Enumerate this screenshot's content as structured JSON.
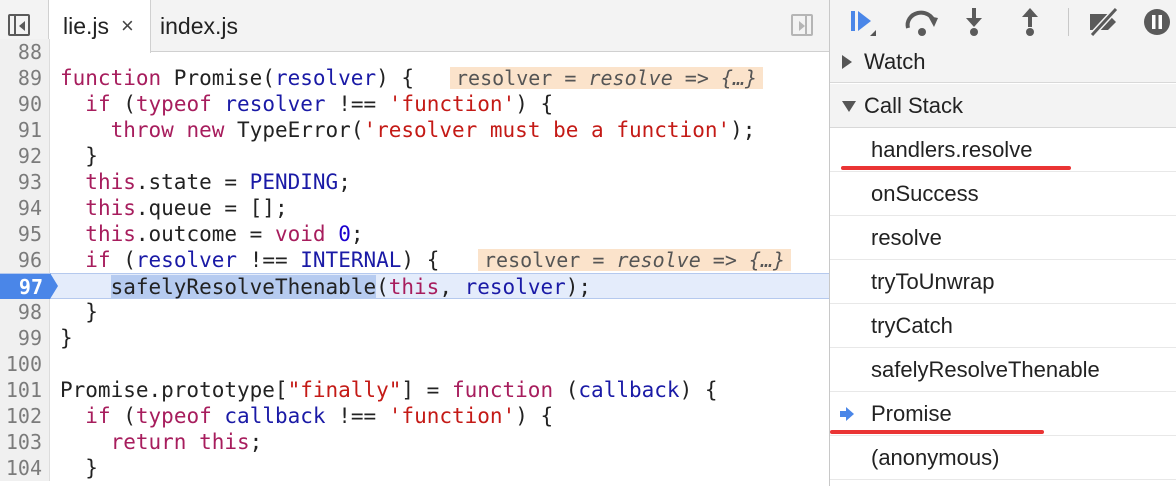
{
  "editor": {
    "tabs": [
      {
        "label": "lie.js",
        "close": "×",
        "active": true
      },
      {
        "label": "index.js",
        "active": false
      }
    ],
    "lines": [
      {
        "num": "88",
        "text": ""
      },
      {
        "num": "89",
        "text": "function Promise(resolver) {"
      },
      {
        "num": "90",
        "text": "  if (typeof resolver !== 'function') {"
      },
      {
        "num": "91",
        "text": "    throw new TypeError('resolver must be a function');"
      },
      {
        "num": "92",
        "text": "  }"
      },
      {
        "num": "93",
        "text": "  this.state = PENDING;"
      },
      {
        "num": "94",
        "text": "  this.queue = [];"
      },
      {
        "num": "95",
        "text": "  this.outcome = void 0;"
      },
      {
        "num": "96",
        "text": "  if (resolver !== INTERNAL) {"
      },
      {
        "num": "97",
        "text": "    safelyResolveThenable(this, resolver);"
      },
      {
        "num": "98",
        "text": "  }"
      },
      {
        "num": "99",
        "text": "}"
      },
      {
        "num": "100",
        "text": ""
      },
      {
        "num": "101",
        "text": "Promise.prototype[\"finally\"] = function (callback) {"
      },
      {
        "num": "102",
        "text": "  if (typeof callback !== 'function') {"
      },
      {
        "num": "103",
        "text": "    return this;"
      },
      {
        "num": "104",
        "text": "  }"
      }
    ],
    "paused_line": "97",
    "inline_hints": {
      "line_89": {
        "name": "resolver",
        "eq": " = ",
        "value": "resolve => {…}"
      },
      "line_96": {
        "name": "resolver",
        "eq": " = ",
        "value": "resolve => {…}"
      }
    }
  },
  "sidebar": {
    "toolbar_icons": [
      "resume-icon",
      "step-over-icon",
      "step-into-icon",
      "step-out-icon",
      "deactivate-breakpoints-icon",
      "pause-on-exceptions-icon"
    ],
    "watch_label": "Watch",
    "call_stack_label": "Call Stack",
    "frames": [
      {
        "label": "handlers.resolve",
        "underlined": true
      },
      {
        "label": "onSuccess"
      },
      {
        "label": "resolve"
      },
      {
        "label": "tryToUnwrap"
      },
      {
        "label": "tryCatch"
      },
      {
        "label": "safelyResolveThenable"
      },
      {
        "label": "Promise",
        "current": true,
        "underlined": true
      },
      {
        "label": "(anonymous)"
      }
    ]
  },
  "colors": {
    "accent": "#4a86e8",
    "annotation_underline": "#ea3434",
    "hint_background": "#fbe3cb"
  }
}
